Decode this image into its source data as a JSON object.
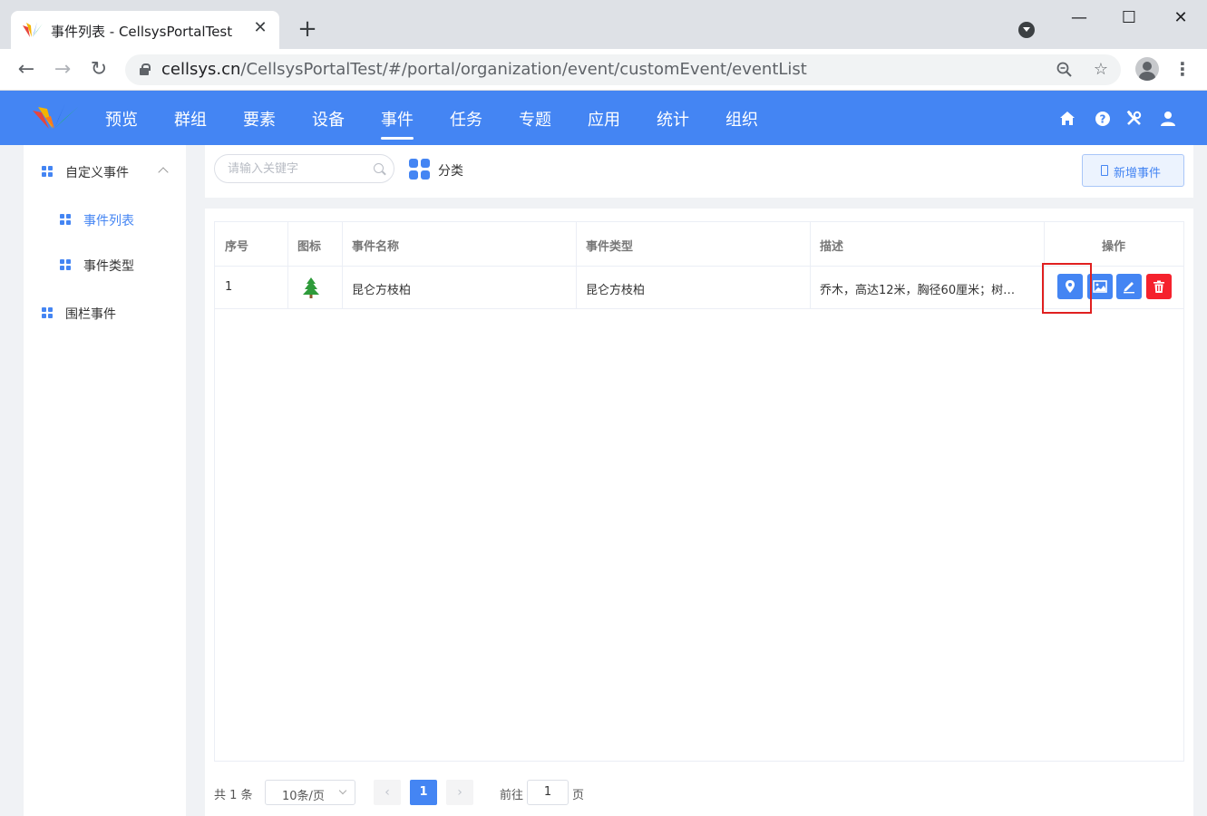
{
  "browser": {
    "tab_title": "事件列表 - CellsysPortalTest",
    "tab_close": "✕",
    "new_tab": "+",
    "url_host": "cellsys.cn",
    "url_path": "/CellsysPortalTest/#/portal/organization/event/customEvent/eventList",
    "window_controls": {
      "minimize": "—",
      "maximize": "☐",
      "close": "✕"
    }
  },
  "app": {
    "nav": [
      "预览",
      "群组",
      "要素",
      "设备",
      "事件",
      "任务",
      "专题",
      "应用",
      "统计",
      "组织"
    ],
    "active_nav": "事件",
    "header_icons": [
      "home-icon",
      "help-icon",
      "tools-icon",
      "user-icon"
    ]
  },
  "sidebar": {
    "items": [
      {
        "label": "自定义事件",
        "level": 1,
        "expanded": true
      },
      {
        "label": "事件列表",
        "level": 2,
        "active": true
      },
      {
        "label": "事件类型",
        "level": 2
      },
      {
        "label": "围栏事件",
        "level": 1
      }
    ]
  },
  "toolbar": {
    "search_placeholder": "请输入关键字",
    "category_label": "分类",
    "add_button": "新增事件"
  },
  "table": {
    "columns": [
      "序号",
      "图标",
      "事件名称",
      "事件类型",
      "描述",
      "操作"
    ],
    "rows": [
      {
        "index": "1",
        "icon": "tree-icon",
        "name": "昆仑方枝柏",
        "type": "昆仑方枝柏",
        "description": "乔木，高达12米，胸径60厘米；树…"
      }
    ],
    "actions": [
      "location-icon",
      "image-icon",
      "edit-icon",
      "delete-icon"
    ]
  },
  "pagination": {
    "total": "共 1 条",
    "page_size": "10条/页",
    "prev": "‹",
    "current_page": "1",
    "next": "›",
    "goto_label": "前往",
    "goto_value": "1",
    "goto_unit": "页"
  },
  "colors": {
    "brand": "#4485f3",
    "danger": "#f5222d",
    "highlight": "#e02020",
    "tree": "#2e9b3a"
  }
}
